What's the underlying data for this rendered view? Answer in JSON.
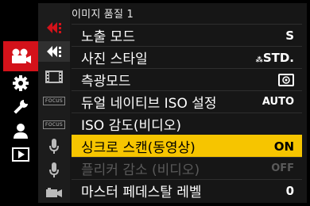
{
  "menu": {
    "title": "이미지 품질 1",
    "rows": [
      {
        "label": "노출 모드",
        "value": "S"
      },
      {
        "label": "사진 스타일",
        "value": "STD."
      },
      {
        "label": "측광모드",
        "value": ""
      },
      {
        "label": "듀얼 네이티브 ISO 설정",
        "value": "AUTO"
      },
      {
        "label": "ISO 감도(비디오)",
        "value": ""
      },
      {
        "label": "싱크로 스캔(동영상)",
        "value": "ON"
      },
      {
        "label": "플리커 감소 (비디오)",
        "value": "OFF"
      },
      {
        "label": "마스터 페데스탈 레벨",
        "value": "0"
      }
    ]
  },
  "sub_tabs": {
    "focus_label": "FOCUS"
  },
  "colors": {
    "accent_red": "#d3121a",
    "highlight_yellow": "#f6c500",
    "panel_bg": "#161616"
  },
  "icons": {
    "main": [
      "video-camera-icon",
      "gear-icon",
      "wrench-icon",
      "person-icon",
      "playback-icon"
    ],
    "sub": [
      "image-quality-1-icon",
      "image-quality-2-icon",
      "film-icon",
      "focus-icon",
      "focus-icon",
      "microphone-icon",
      "microphone-icon",
      "video-camera-small-icon"
    ]
  }
}
